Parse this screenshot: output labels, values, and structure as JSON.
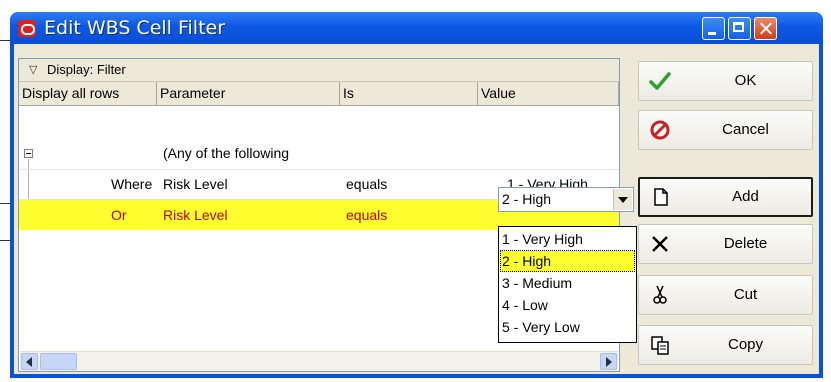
{
  "window": {
    "title": "Edit WBS Cell Filter"
  },
  "titlebar": {
    "minimize_icon": "minimize-icon",
    "maximize_icon": "maximize-icon",
    "close_icon": "close-icon"
  },
  "group_bar": {
    "label": "Display: Filter"
  },
  "columns": [
    "Display all rows",
    "Parameter",
    "Is",
    "Value"
  ],
  "rows": [
    {
      "col0": "",
      "parameter": "(Any of the following",
      "is": "",
      "value": ""
    },
    {
      "col0": "Where",
      "parameter": "Risk Level",
      "is": "equals",
      "value": "1 - Very High"
    },
    {
      "col0": "Or",
      "parameter": "Risk Level",
      "is": "equals",
      "value": "2 - High"
    }
  ],
  "value_combo": {
    "selected": "2 - High",
    "options": [
      "1 - Very High",
      "2 - High",
      "3 - Medium",
      "4 - Low",
      "5 - Very Low"
    ]
  },
  "buttons": {
    "ok": "OK",
    "cancel": "Cancel",
    "add": "Add",
    "delete": "Delete",
    "cut": "Cut",
    "copy": "Copy"
  },
  "colors": {
    "highlight": "#ffff30",
    "highlight_text": "#c00000",
    "titlebar": "#0a53d8"
  }
}
